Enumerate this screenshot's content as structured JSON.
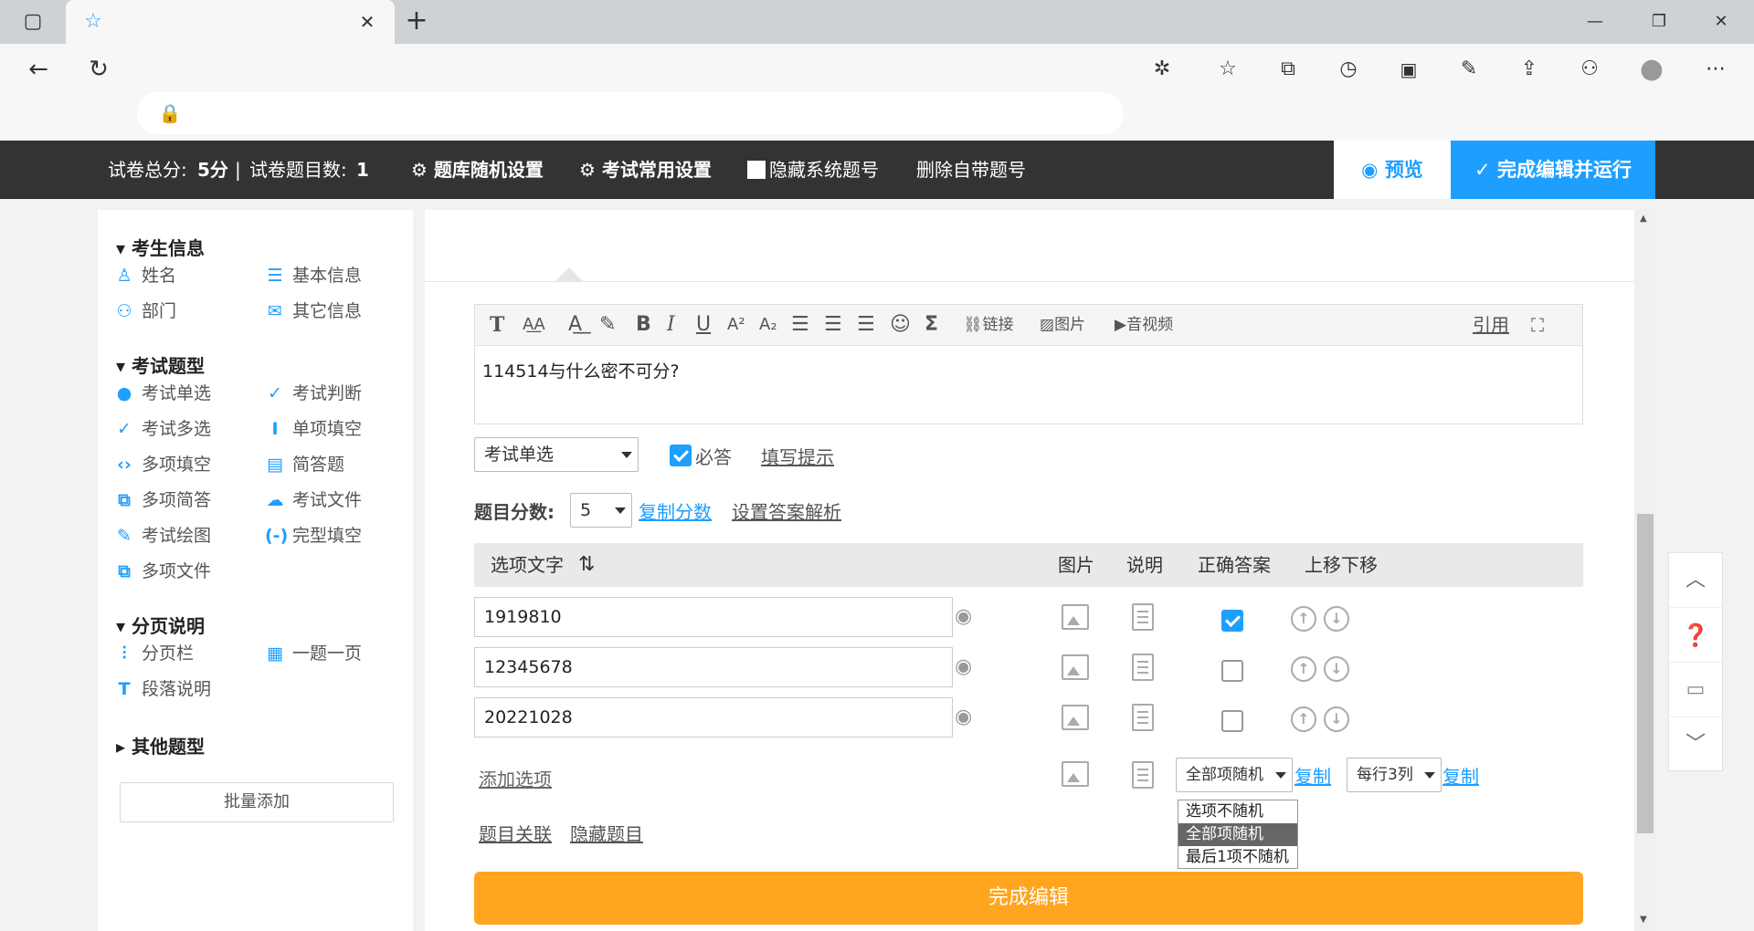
{
  "browser": {
    "tab_title": "",
    "address": "",
    "window_controls": {
      "minimize": "—",
      "maximize": "❐",
      "close": "✕"
    }
  },
  "header": {
    "score_label": "试卷总分:",
    "score_value": "5分",
    "separator": "|",
    "count_label": "试卷题目数:",
    "count_value": "1",
    "random_settings": "题库随机设置",
    "common_settings": "考试常用设置",
    "hide_numbers": "隐藏系统题号",
    "delete_numbers": "删除自带题号",
    "preview": "预览",
    "finish_run": "完成编辑并运行"
  },
  "sidebar": {
    "sections": [
      {
        "title": "考生信息",
        "items": [
          "姓名",
          "基本信息",
          "部门",
          "其它信息"
        ]
      },
      {
        "title": "考试题型",
        "items": [
          "考试单选",
          "考试判断",
          "考试多选",
          "单项填空",
          "多项填空",
          "简答题",
          "多项简答",
          "考试文件",
          "考试绘图",
          "完型填空",
          "多项文件"
        ]
      },
      {
        "title": "分页说明",
        "items": [
          "分页栏",
          "一题一页",
          "段落说明"
        ]
      },
      {
        "title": "其他题型",
        "items": []
      }
    ],
    "batch_add": "批量添加"
  },
  "editor": {
    "toolbar": {
      "link": "链接",
      "image": "图片",
      "media": "音视频",
      "quote": "引用"
    },
    "content": "114514与什么密不可分?"
  },
  "question": {
    "type": "考试单选",
    "required_label": "必答",
    "required": true,
    "hint_link": "填写提示",
    "score_label": "题目分数:",
    "score_value": "5",
    "copy_score": "复制分数",
    "set_analysis": "设置答案解析"
  },
  "options_table": {
    "headers": {
      "text": "选项文字",
      "image": "图片",
      "note": "说明",
      "correct": "正确答案",
      "move": "上移下移"
    },
    "rows": [
      {
        "text": "1919810",
        "correct": true
      },
      {
        "text": "12345678",
        "correct": false
      },
      {
        "text": "20221028",
        "correct": false
      }
    ],
    "add_option": "添加选项",
    "random_select": "全部项随机",
    "copy1": "复制",
    "cols_select": "每行3列",
    "copy2": "复制",
    "random_options": [
      "选项不随机",
      "全部项随机",
      "最后1项不随机"
    ]
  },
  "bottom_links": {
    "relation": "题目关联",
    "hide": "隐藏题目"
  },
  "finish_button": "完成编辑",
  "accent_colors": {
    "blue": "#1e9fff",
    "orange": "#ffa51f",
    "dark": "#333333"
  }
}
